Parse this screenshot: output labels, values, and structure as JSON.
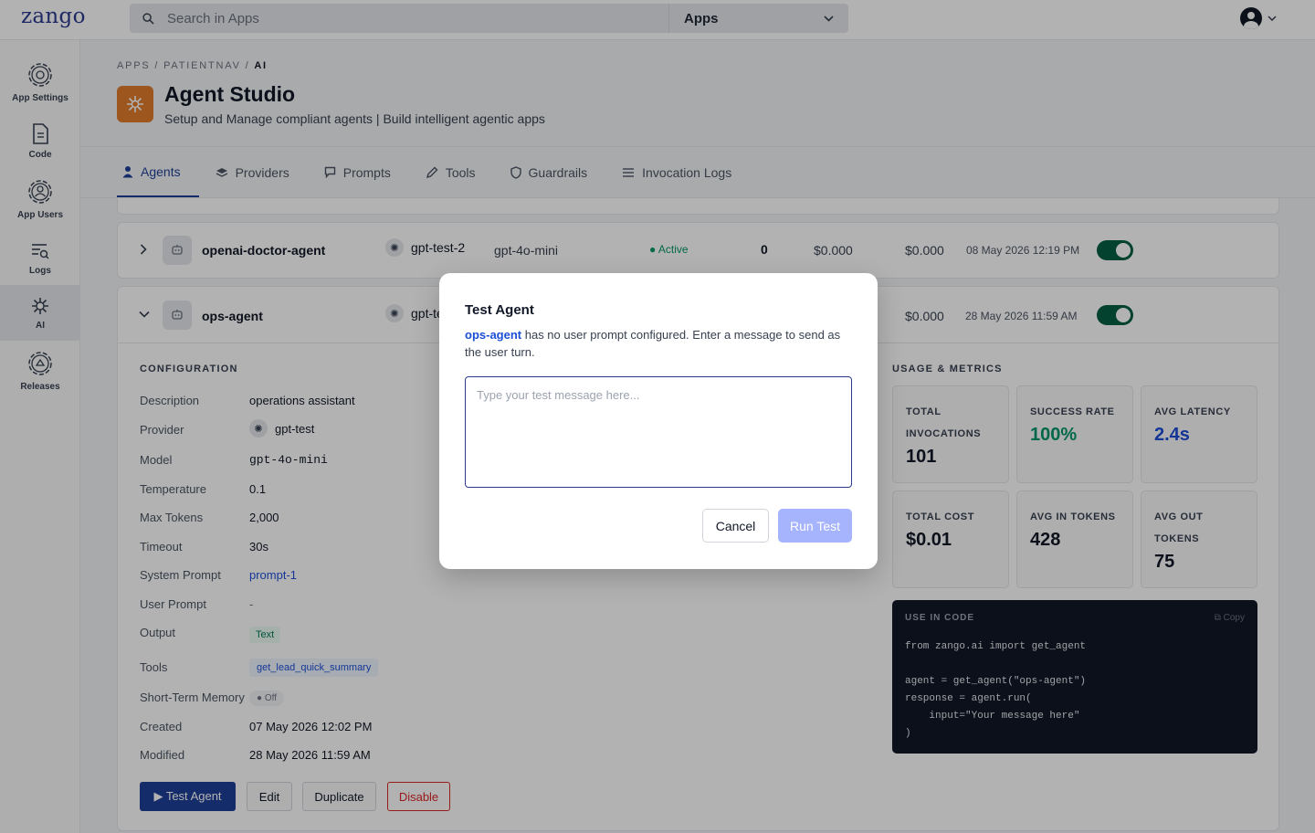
{
  "topbar": {
    "logo": "zango",
    "search_placeholder": "Search in Apps",
    "apps_selector": "Apps",
    "icons": [
      "search-icon",
      "chevron-down-icon",
      "user-avatar-icon"
    ]
  },
  "sidebar": {
    "items": [
      {
        "label": "App Settings",
        "icon": "gear-icon"
      },
      {
        "label": "Code",
        "icon": "document-icon"
      },
      {
        "label": "App Users",
        "icon": "users-gear-icon"
      },
      {
        "label": "Logs",
        "icon": "logs-search-icon"
      },
      {
        "label": "AI",
        "icon": "sparkle-icon",
        "active": true
      },
      {
        "label": "Releases",
        "icon": "release-gear-icon"
      }
    ]
  },
  "header": {
    "breadcrumb_prefix": "APPS / PATIENTNAV / ",
    "breadcrumb_current": "AI",
    "title": "Agent Studio",
    "subtitle": "Setup and Manage compliant agents | Build intelligent agentic apps"
  },
  "tabs": [
    {
      "label": "Agents",
      "icon": "person-icon",
      "active": true
    },
    {
      "label": "Providers",
      "icon": "layers-icon"
    },
    {
      "label": "Prompts",
      "icon": "chat-icon"
    },
    {
      "label": "Tools",
      "icon": "pencil-icon"
    },
    {
      "label": "Guardrails",
      "icon": "shield-icon"
    },
    {
      "label": "Invocation Logs",
      "icon": "list-icon"
    }
  ],
  "agents": [
    {
      "name": "openai-doctor-agent",
      "provider": "gpt-test-2",
      "model": "gpt-4o-mini",
      "status": "● Active",
      "invocations": "0",
      "cost_a": "$0.000",
      "cost_b": "$0.000",
      "date": "08 May 2026 12:19 PM",
      "enabled": true
    },
    {
      "name": "ops-agent",
      "provider": "gpt-te",
      "cost_b": "$0.000",
      "date": "28 May 2026 11:59 AM",
      "enabled": true
    }
  ],
  "config": {
    "section_label": "CONFIGURATION",
    "rows": [
      {
        "key": "Description",
        "value": "operations assistant"
      },
      {
        "key": "Provider",
        "value": "gpt-test"
      },
      {
        "key": "Model",
        "value": "gpt-4o-mini"
      },
      {
        "key": "Temperature",
        "value": "0.1"
      },
      {
        "key": "Max Tokens",
        "value": "2,000"
      },
      {
        "key": "Timeout",
        "value": "30s"
      },
      {
        "key": "System Prompt",
        "value": "prompt-1"
      },
      {
        "key": "User Prompt",
        "value": "-"
      },
      {
        "key": "Output",
        "value": "Text"
      },
      {
        "key": "Tools",
        "value": "get_lead_quick_summary"
      },
      {
        "key": "Short-Term Memory",
        "value": "Off"
      },
      {
        "key": "Created",
        "value": "07 May 2026 12:02 PM"
      },
      {
        "key": "Modified",
        "value": "28 May 2026 11:59 AM"
      }
    ]
  },
  "metrics": {
    "section_label": "USAGE & METRICS",
    "cards": [
      {
        "label": "TOTAL INVOCATIONS",
        "value": "101",
        "color": "#111827"
      },
      {
        "label": "SUCCESS RATE",
        "value": "100%",
        "color": "#059669"
      },
      {
        "label": "AVG LATENCY",
        "value": "2.4s",
        "color": "#1d4ed8"
      },
      {
        "label": "TOTAL COST",
        "value": "$0.01",
        "color": "#111827"
      },
      {
        "label": "AVG IN TOKENS",
        "value": "428",
        "color": "#111827"
      },
      {
        "label": "AVG OUT TOKENS",
        "value": "75",
        "color": "#111827"
      }
    ]
  },
  "code": {
    "label": "USE IN CODE",
    "copy_label": "Copy",
    "snippet": "from zango.ai import get_agent\n\nagent = get_agent(\"ops-agent\")\nresponse = agent.run(\n    input=\"Your message here\"\n)"
  },
  "actions": {
    "test_agent": "▶  Test Agent",
    "edit": "Edit",
    "duplicate": "Duplicate",
    "disable": "Disable"
  },
  "modal": {
    "title": "Test Agent",
    "agent_name": "ops-agent",
    "description": " has no user prompt configured. Enter a message to send as the user turn.",
    "placeholder": "Type your test message here...",
    "cancel": "Cancel",
    "run": "Run Test"
  },
  "colors": {
    "brand": "#2b3a8f",
    "primary_button": "#1f3f99",
    "run_disabled": "#a5b4fc",
    "active_green": "#059669",
    "app_icon": "#e07b2c",
    "danger": "#dc2626"
  }
}
